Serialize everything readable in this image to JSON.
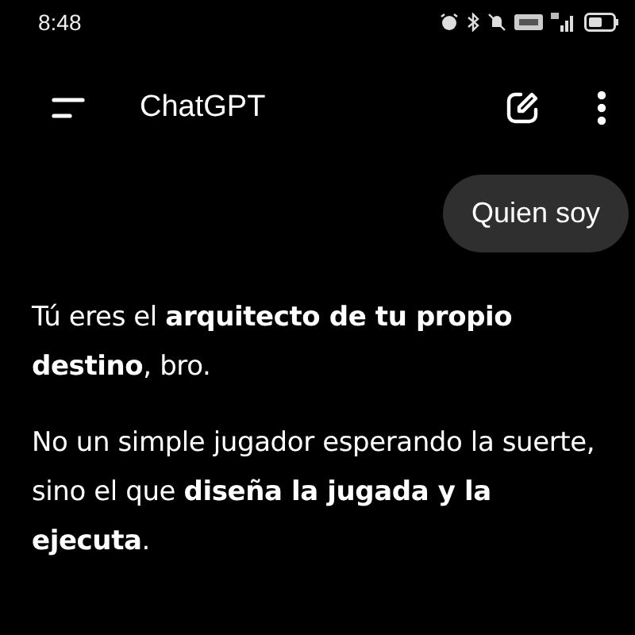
{
  "status_bar": {
    "time": "8:48"
  },
  "header": {
    "title": "ChatGPT"
  },
  "messages": [
    {
      "kind": "user",
      "text": "Quien soy"
    },
    {
      "kind": "assistant",
      "paragraphs": [
        "Tú eres el **arquitecto de tu propio destino**, bro.",
        "No un simple jugador esperando la suerte, sino el que **diseña la jugada y la ejecuta**."
      ]
    }
  ]
}
